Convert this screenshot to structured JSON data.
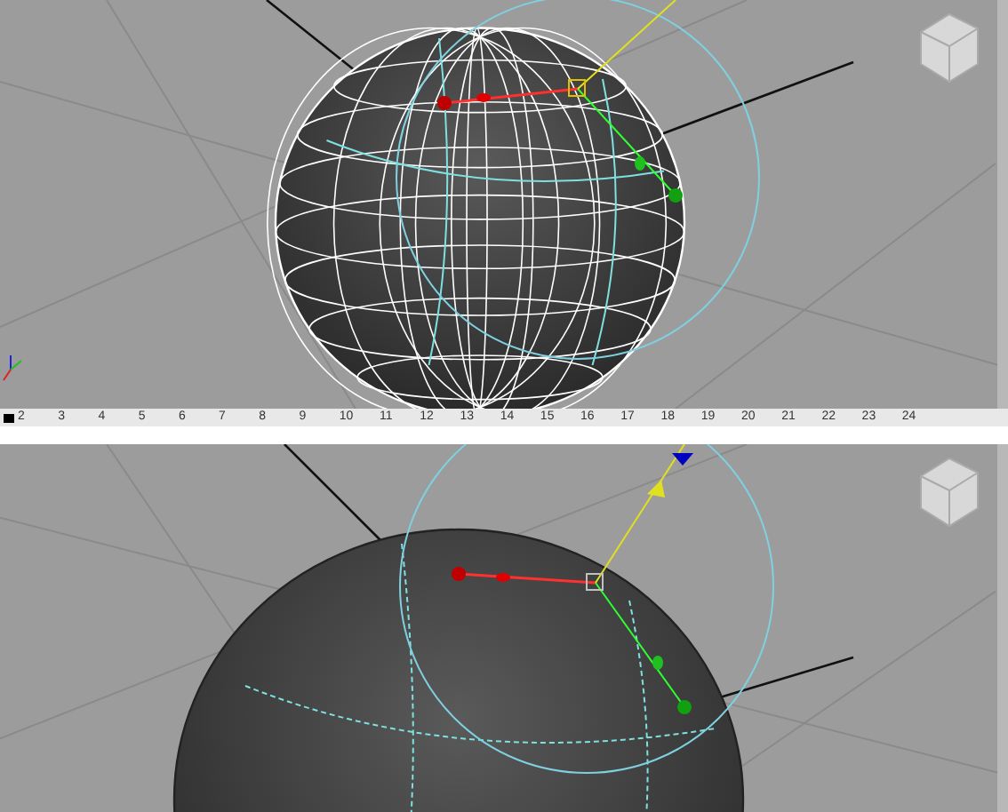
{
  "timeline": {
    "frames": [
      "2",
      "3",
      "4",
      "5",
      "6",
      "7",
      "8",
      "9",
      "10",
      "11",
      "12",
      "13",
      "14",
      "15",
      "16",
      "17",
      "18",
      "19",
      "20",
      "21",
      "22",
      "23",
      "24"
    ]
  }
}
